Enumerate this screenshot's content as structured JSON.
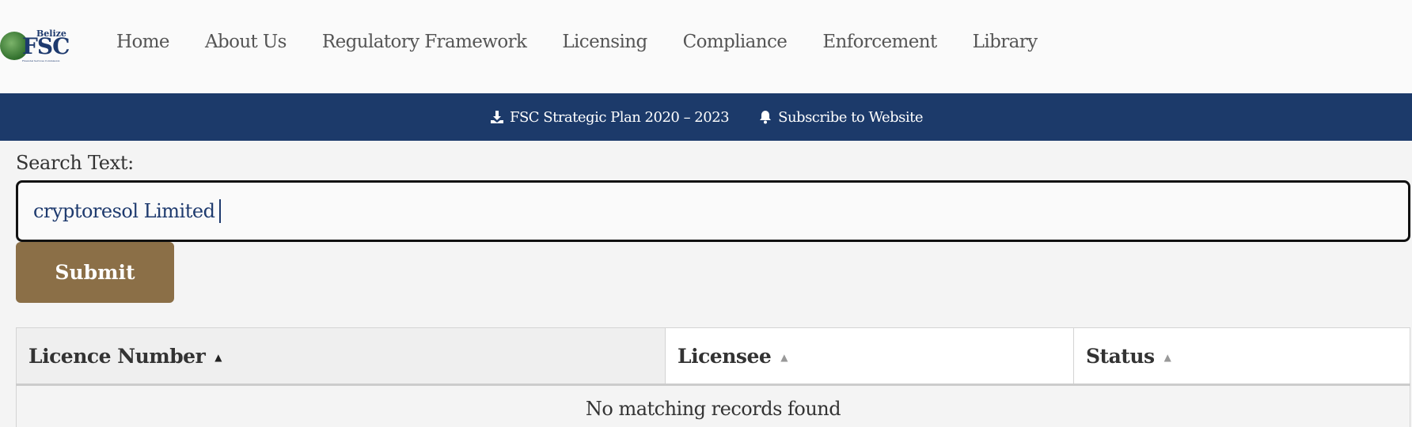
{
  "logo": {
    "top_text": "Belize",
    "main_text": "FSC",
    "tagline": "Financial Services Commission"
  },
  "nav": {
    "items": [
      "Home",
      "About Us",
      "Regulatory Framework",
      "Licensing",
      "Compliance",
      "Enforcement",
      "Library"
    ]
  },
  "banner": {
    "links": [
      {
        "label": "FSC Strategic Plan 2020 – 2023",
        "icon": "download-icon"
      },
      {
        "label": "Subscribe to Website",
        "icon": "bell-icon"
      }
    ],
    "bg_color": "#1c3a6a"
  },
  "search": {
    "label": "Search Text:",
    "value": "cryptoresol Limited",
    "submit_label": "Submit",
    "submit_color": "#8b6f47"
  },
  "table": {
    "columns": [
      {
        "label": "Licence Number",
        "sort": "ascending",
        "active": true
      },
      {
        "label": "Licensee",
        "sort": "ascending",
        "active": false
      },
      {
        "label": "Status",
        "sort": "ascending",
        "active": false
      }
    ],
    "empty_message": "No matching records found"
  }
}
